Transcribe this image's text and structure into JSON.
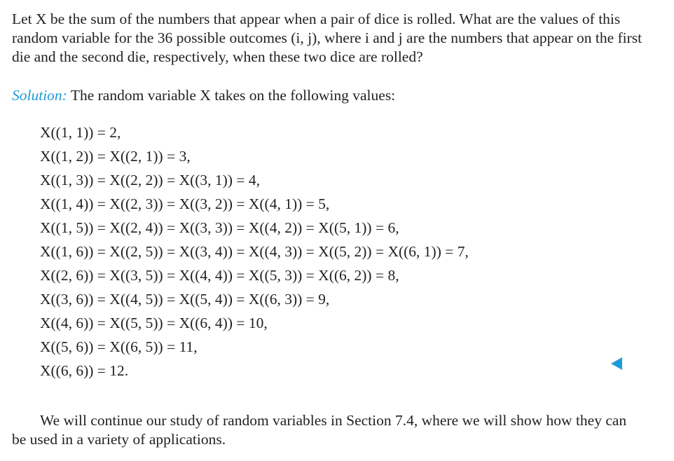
{
  "problem": {
    "text": "Let X be the sum of the numbers that appear when a pair of dice is rolled. What are the values of this random variable for the 36 possible outcomes (i, j), where i and j are the numbers that appear on the first die and the second die, respectively, when these two dice are rolled?"
  },
  "solution": {
    "label": "Solution:",
    "intro": "The random variable X takes on the following values:"
  },
  "equations": [
    "X((1, 1)) = 2,",
    "X((1, 2)) = X((2, 1)) = 3,",
    "X((1, 3)) = X((2, 2)) = X((3, 1)) = 4,",
    "X((1, 4)) = X((2, 3)) = X((3, 2)) = X((4, 1)) = 5,",
    "X((1, 5)) = X((2, 4)) = X((3, 3)) = X((4, 2)) = X((5, 1)) = 6,",
    "X((1, 6)) = X((2, 5)) = X((3, 4)) = X((4, 3)) = X((5, 2)) = X((6, 1)) = 7,",
    "X((2, 6)) = X((3, 5)) = X((4, 4)) = X((5, 3)) = X((6, 2)) = 8,",
    "X((3, 6)) = X((4, 5)) = X((5, 4)) = X((6, 3)) = 9,",
    "X((4, 6)) = X((5, 5)) = X((6, 4)) = 10,",
    "X((5, 6)) = X((6, 5)) = 11,",
    "X((6, 6)) = 12."
  ],
  "closing": {
    "text": "We will continue our study of random variables in Section 7.4, where we will show how they can be used in a variety of applications."
  },
  "colors": {
    "accent": "#1f9bd8",
    "text": "#231f20"
  },
  "icons": {
    "end_marker": "end-of-solution-triangle-icon"
  }
}
